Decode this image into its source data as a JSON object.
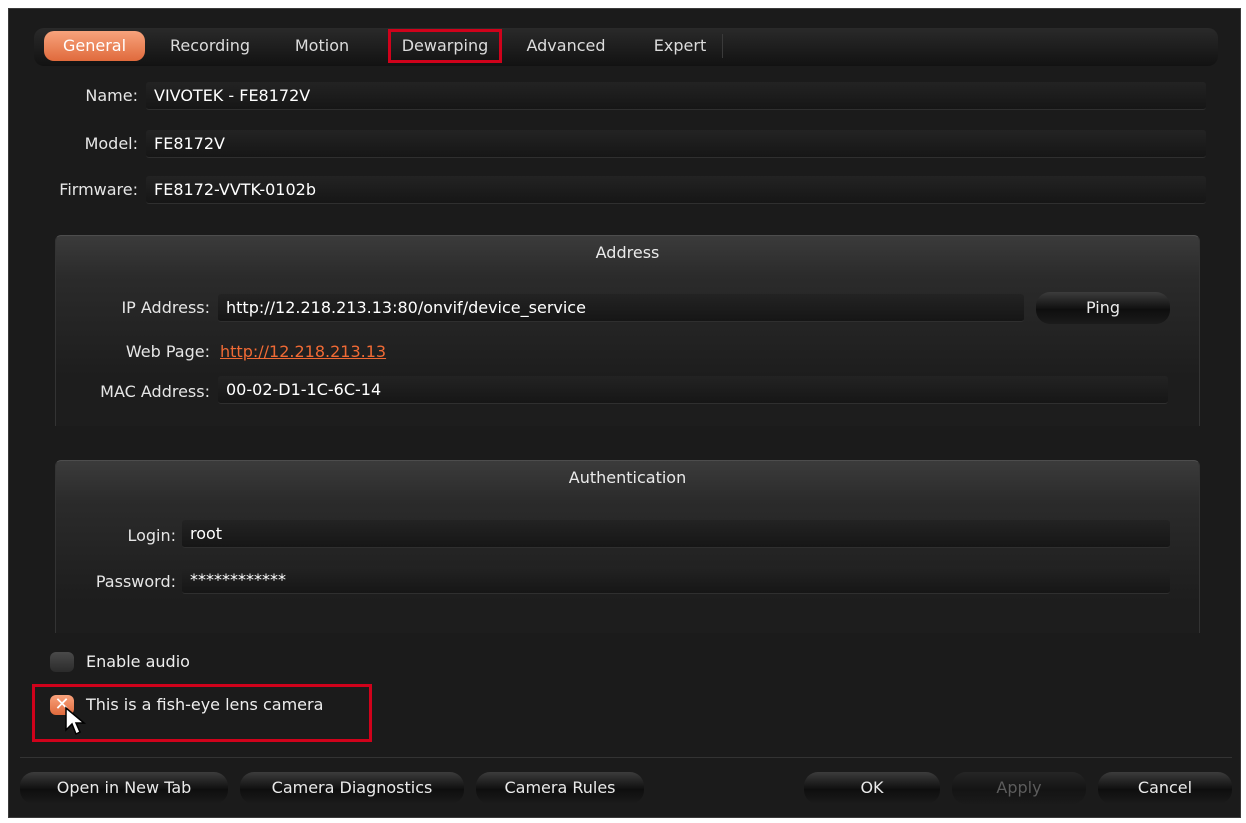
{
  "tabs": [
    {
      "label": "General",
      "active": true
    },
    {
      "label": "Recording",
      "active": false
    },
    {
      "label": "Motion",
      "active": false
    },
    {
      "label": "Dewarping",
      "active": false
    },
    {
      "label": "Advanced",
      "active": false
    },
    {
      "label": "Expert",
      "active": false
    }
  ],
  "device": {
    "name_label": "Name:",
    "name_value": "VIVOTEK - FE8172V",
    "model_label": "Model:",
    "model_value": "FE8172V",
    "firmware_label": "Firmware:",
    "firmware_value": "FE8172-VVTK-0102b"
  },
  "address": {
    "title": "Address",
    "ip_label": "IP Address:",
    "ip_value": "http://12.218.213.13:80/onvif/device_service",
    "ping_label": "Ping",
    "web_label": "Web Page:",
    "web_value": "http://12.218.213.13",
    "mac_label": "MAC Address:",
    "mac_value": "00-02-D1-1C-6C-14"
  },
  "authentication": {
    "title": "Authentication",
    "login_label": "Login:",
    "login_value": "root",
    "password_label": "Password:",
    "password_value": "************"
  },
  "options": {
    "enable_audio": "Enable audio",
    "enable_audio_checked": false,
    "fisheye": "This is a fish-eye lens camera",
    "fisheye_checked": true
  },
  "buttons": {
    "open_new_tab": "Open in New Tab",
    "diagnostics": "Camera Diagnostics",
    "rules": "Camera Rules",
    "ok": "OK",
    "apply": "Apply",
    "cancel": "Cancel"
  },
  "colors": {
    "accent": "#e8784a",
    "link": "#f06a35",
    "highlight": "#d0021b",
    "background": "#1b1b1b"
  }
}
